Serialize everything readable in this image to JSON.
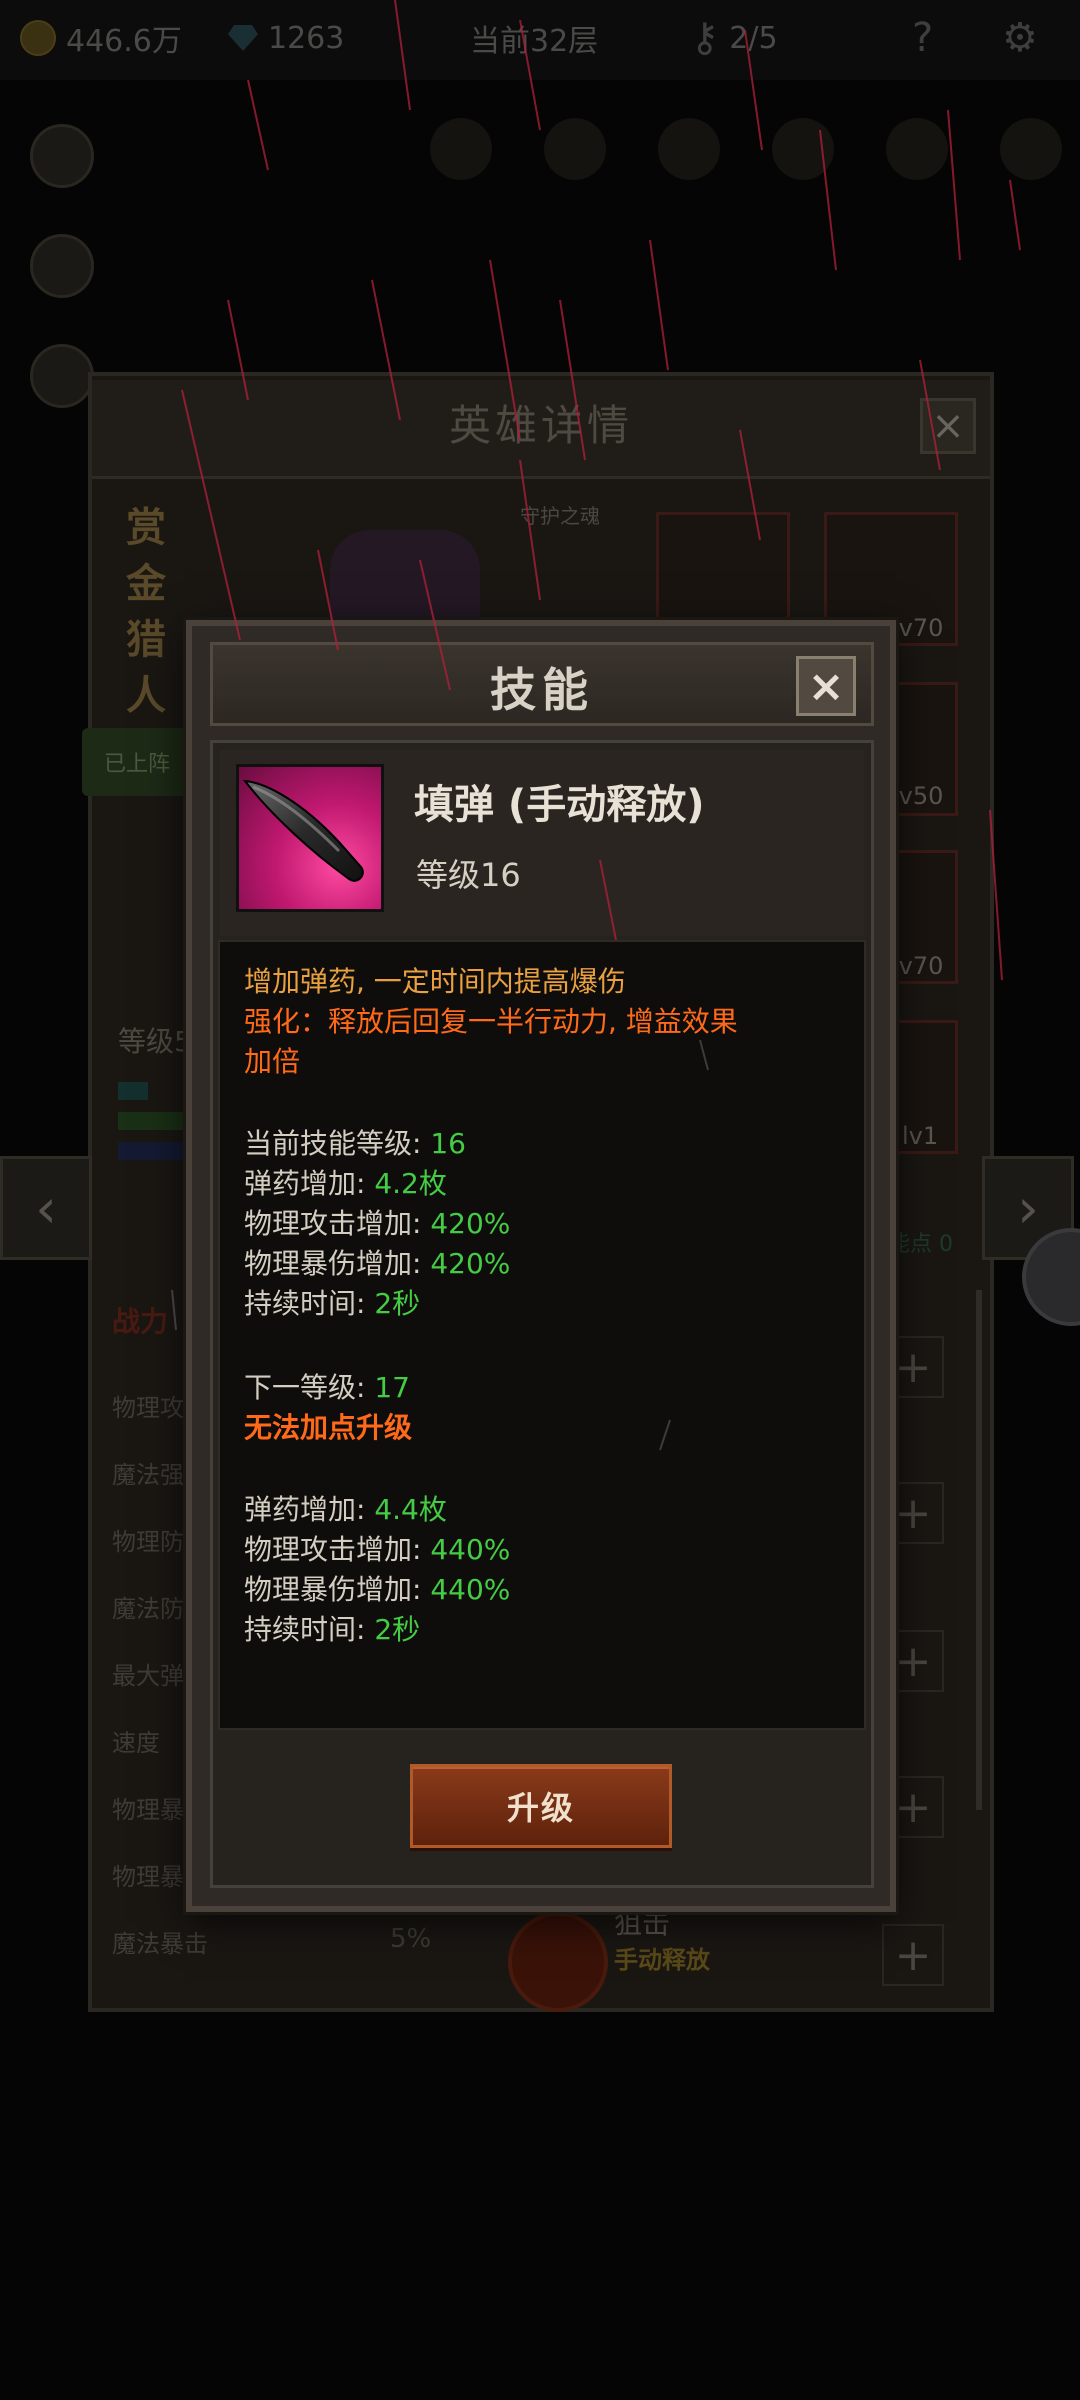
{
  "topbar": {
    "gold": "446.6万",
    "gems": "1263",
    "floor": "当前32层",
    "keys": "2/5"
  },
  "hero_panel": {
    "title": "英雄详情",
    "hero_name": "赏金猎人",
    "deployed_label": "已上阵",
    "guard_label": "守护之魂",
    "level_label": "等级5",
    "stats_tab": "战力",
    "ability_points": "能点 0",
    "equipment": [
      {
        "level": "lv70"
      },
      {
        "level": "lv50"
      },
      {
        "level": "lv70"
      },
      {
        "level": "lv1"
      }
    ],
    "stat_rows": [
      "物理攻",
      "魔法强",
      "物理防",
      "魔法防",
      "最大弹",
      "速度",
      "物理暴",
      "物理暴",
      "魔法暴击"
    ],
    "magic_crit_value": "5%",
    "skill_sniper": {
      "name": "狙击",
      "sub": "手动释放"
    }
  },
  "dialog": {
    "title": "技能",
    "close_label": "×",
    "skill_name": "填弹 (手动释放)",
    "skill_level": "等级16",
    "desc_line1": "增加弹药, 一定时间内提高爆伤",
    "desc_line2": "强化：释放后回复一半行动力, 增益效果",
    "desc_line3": "加倍",
    "current": {
      "level_label": "当前技能等级: ",
      "level_value": "16",
      "ammo_label": "弹药增加: ",
      "ammo_value": "4.2枚",
      "patk_label": "物理攻击增加: ",
      "patk_value": "420%",
      "pcrit_label": "物理暴伤增加: ",
      "pcrit_value": "420%",
      "dur_label": "持续时间: ",
      "dur_value": "2秒"
    },
    "next": {
      "level_label": "下一等级: ",
      "level_value": "17",
      "warning": "无法加点升级",
      "ammo_label": "弹药增加: ",
      "ammo_value": "4.4枚",
      "patk_label": "物理攻击增加: ",
      "patk_value": "440%",
      "pcrit_label": "物理暴伤增加: ",
      "pcrit_value": "440%",
      "dur_label": "持续时间: ",
      "dur_value": "2秒"
    },
    "upgrade_label": "升级"
  },
  "colors": {
    "accent_orange": "#e8a040",
    "accent_red": "#ff6a1a",
    "value_green": "#44cc44",
    "button_brown": "#7a3214"
  }
}
